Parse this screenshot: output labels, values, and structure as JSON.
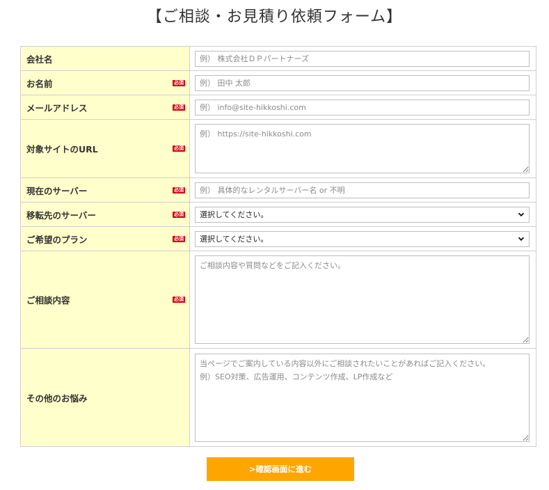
{
  "page": {
    "title": "【ご相談・お見積り依頼フォーム】"
  },
  "required_badge": "必須",
  "fields": [
    {
      "label": "会社名",
      "required": false,
      "placeholder": "例） 株式会社ＤＰパートナーズ"
    },
    {
      "label": "お名前",
      "required": true,
      "placeholder": "例） 田中 太郎"
    },
    {
      "label": "メールアドレス",
      "required": true,
      "placeholder": "例） info@site-hikkoshi.com"
    },
    {
      "label": "対象サイトのURL",
      "required": true,
      "placeholder": "例） https://site-hikkoshi.com"
    },
    {
      "label": "現在のサーバー",
      "required": true,
      "placeholder": "例） 具体的なレンタルサーバー名 or 不明"
    },
    {
      "label": "移転先のサーバー",
      "required": true,
      "value": "選択してください。"
    },
    {
      "label": "ご希望のプラン",
      "required": true,
      "value": "選択してください。"
    },
    {
      "label": "ご相談内容",
      "required": true,
      "placeholder": "ご相談内容や質問などをご記入ください。"
    },
    {
      "label": "その他のお悩み",
      "required": false,
      "placeholder": "当ページでご案内している内容以外にご相談されたいことがあればご記入ください。\n例）SEO対策、広告運用、コンテンツ作成、LP作成など"
    }
  ],
  "submit": {
    "label": ">確認画面に進む"
  },
  "colors": {
    "label_bg": "#ffffcc",
    "required_badge": "#d6000f",
    "submit_bg": "#ffa500"
  }
}
